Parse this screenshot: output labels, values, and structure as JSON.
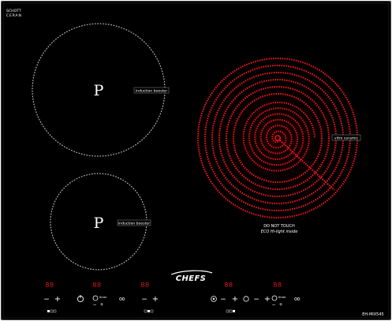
{
  "brand_mark": [
    "SCHOTT",
    "CERAN"
  ],
  "zones": [
    {
      "name": "rear-left",
      "type": "induction",
      "symbol": "P",
      "label": "induction booster"
    },
    {
      "name": "front-left",
      "type": "induction",
      "symbol": "P",
      "label": "induction booster"
    },
    {
      "name": "right",
      "type": "radiant",
      "label": "vitro ceramic",
      "warning": [
        "DO NOT TOUCH",
        "ECO Hi-light inside"
      ]
    }
  ],
  "logo": "CHEFS",
  "model": "EH-MIX545",
  "controls": {
    "digit_display": "88",
    "timer_label": "timer",
    "minus": "−",
    "plus": "+"
  },
  "colors": {
    "glass": "#000000",
    "frame": "#3a3a3a",
    "dotted_ring": "#b8b8b8",
    "heating_coil": "#e4161e",
    "led": "#e0141a",
    "text": "#ffffff"
  }
}
